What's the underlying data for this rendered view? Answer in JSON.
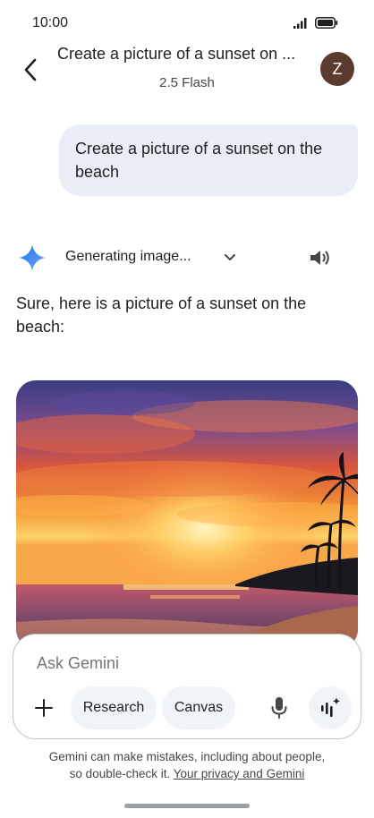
{
  "status_bar": {
    "time": "10:00"
  },
  "header": {
    "title": "Create a picture of a sunset on ...",
    "model": "2.5 Flash",
    "avatar_initial": "Z"
  },
  "user_message": "Create a picture of a sunset on the beach",
  "reply": {
    "status": "Generating image...",
    "text": "Sure, here is a picture of a sunset on the beach:"
  },
  "composer": {
    "placeholder": "Ask Gemini",
    "chips": [
      "Research",
      "Canvas"
    ]
  },
  "disclaimer": {
    "line1": "Gemini can make mistakes, including about people,",
    "line2_prefix": "so double-check it. ",
    "link": "Your privacy and Gemini"
  },
  "colors": {
    "user_bubble": "#e9eef6",
    "chip_bg": "#f0f4f9",
    "avatar_bg": "#5b3a30",
    "gemini_blue": "#4285f4"
  },
  "icons": [
    "back-arrow-icon",
    "signal-icon",
    "battery-icon",
    "gemini-star-icon",
    "chevron-down-icon",
    "speaker-icon",
    "plus-icon",
    "microphone-icon",
    "live-audio-icon"
  ]
}
